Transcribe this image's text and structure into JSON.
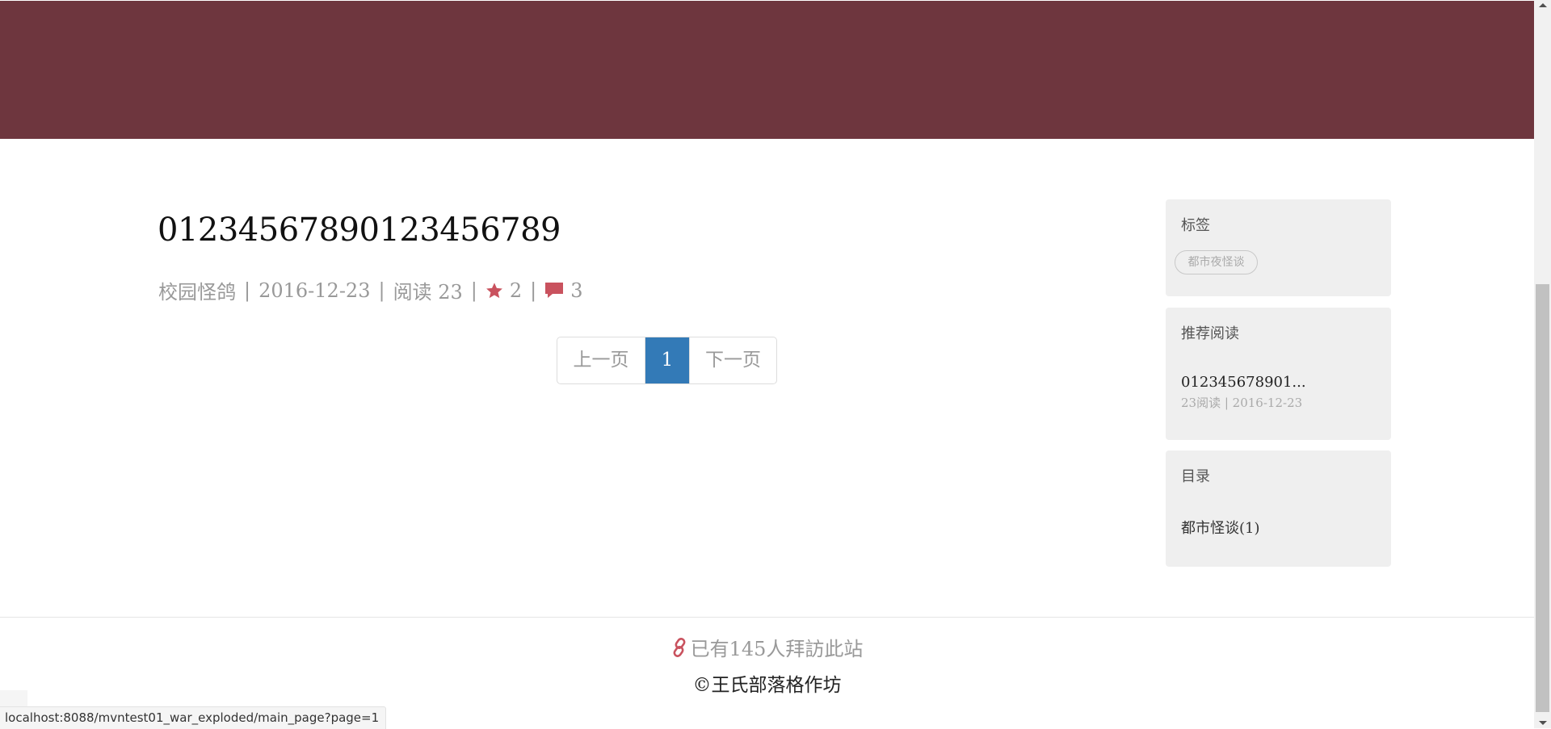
{
  "post": {
    "title": "01234567890123456789",
    "category": "校园怪鸽",
    "date": "2016-12-23",
    "views": "阅读 23",
    "stars": "2",
    "comments": "3",
    "separator": "|"
  },
  "pagination": {
    "prev": "上一页",
    "current": "1",
    "next": "下一页"
  },
  "sidebar": {
    "tags": {
      "title": "标签",
      "items": [
        "都市夜怪谈"
      ]
    },
    "recommended": {
      "title": "推荐阅读",
      "item_title": "012345678901...",
      "item_meta": "23阅读 | 2016-12-23"
    },
    "toc": {
      "title": "目录",
      "items": [
        "都市怪谈(1)"
      ]
    }
  },
  "footer": {
    "visitors": "已有145人拜訪此站",
    "copyright": "©王氏部落格作坊"
  },
  "status_bar": {
    "url": "localhost:8088/mvntest01_war_exploded/main_page?page=1"
  },
  "icons": {
    "star": "star-icon",
    "comment": "comment-icon",
    "link": "link-icon"
  },
  "colors": {
    "header": "#6e363e",
    "accent": "#c9525e",
    "active_page": "#337ab7"
  }
}
